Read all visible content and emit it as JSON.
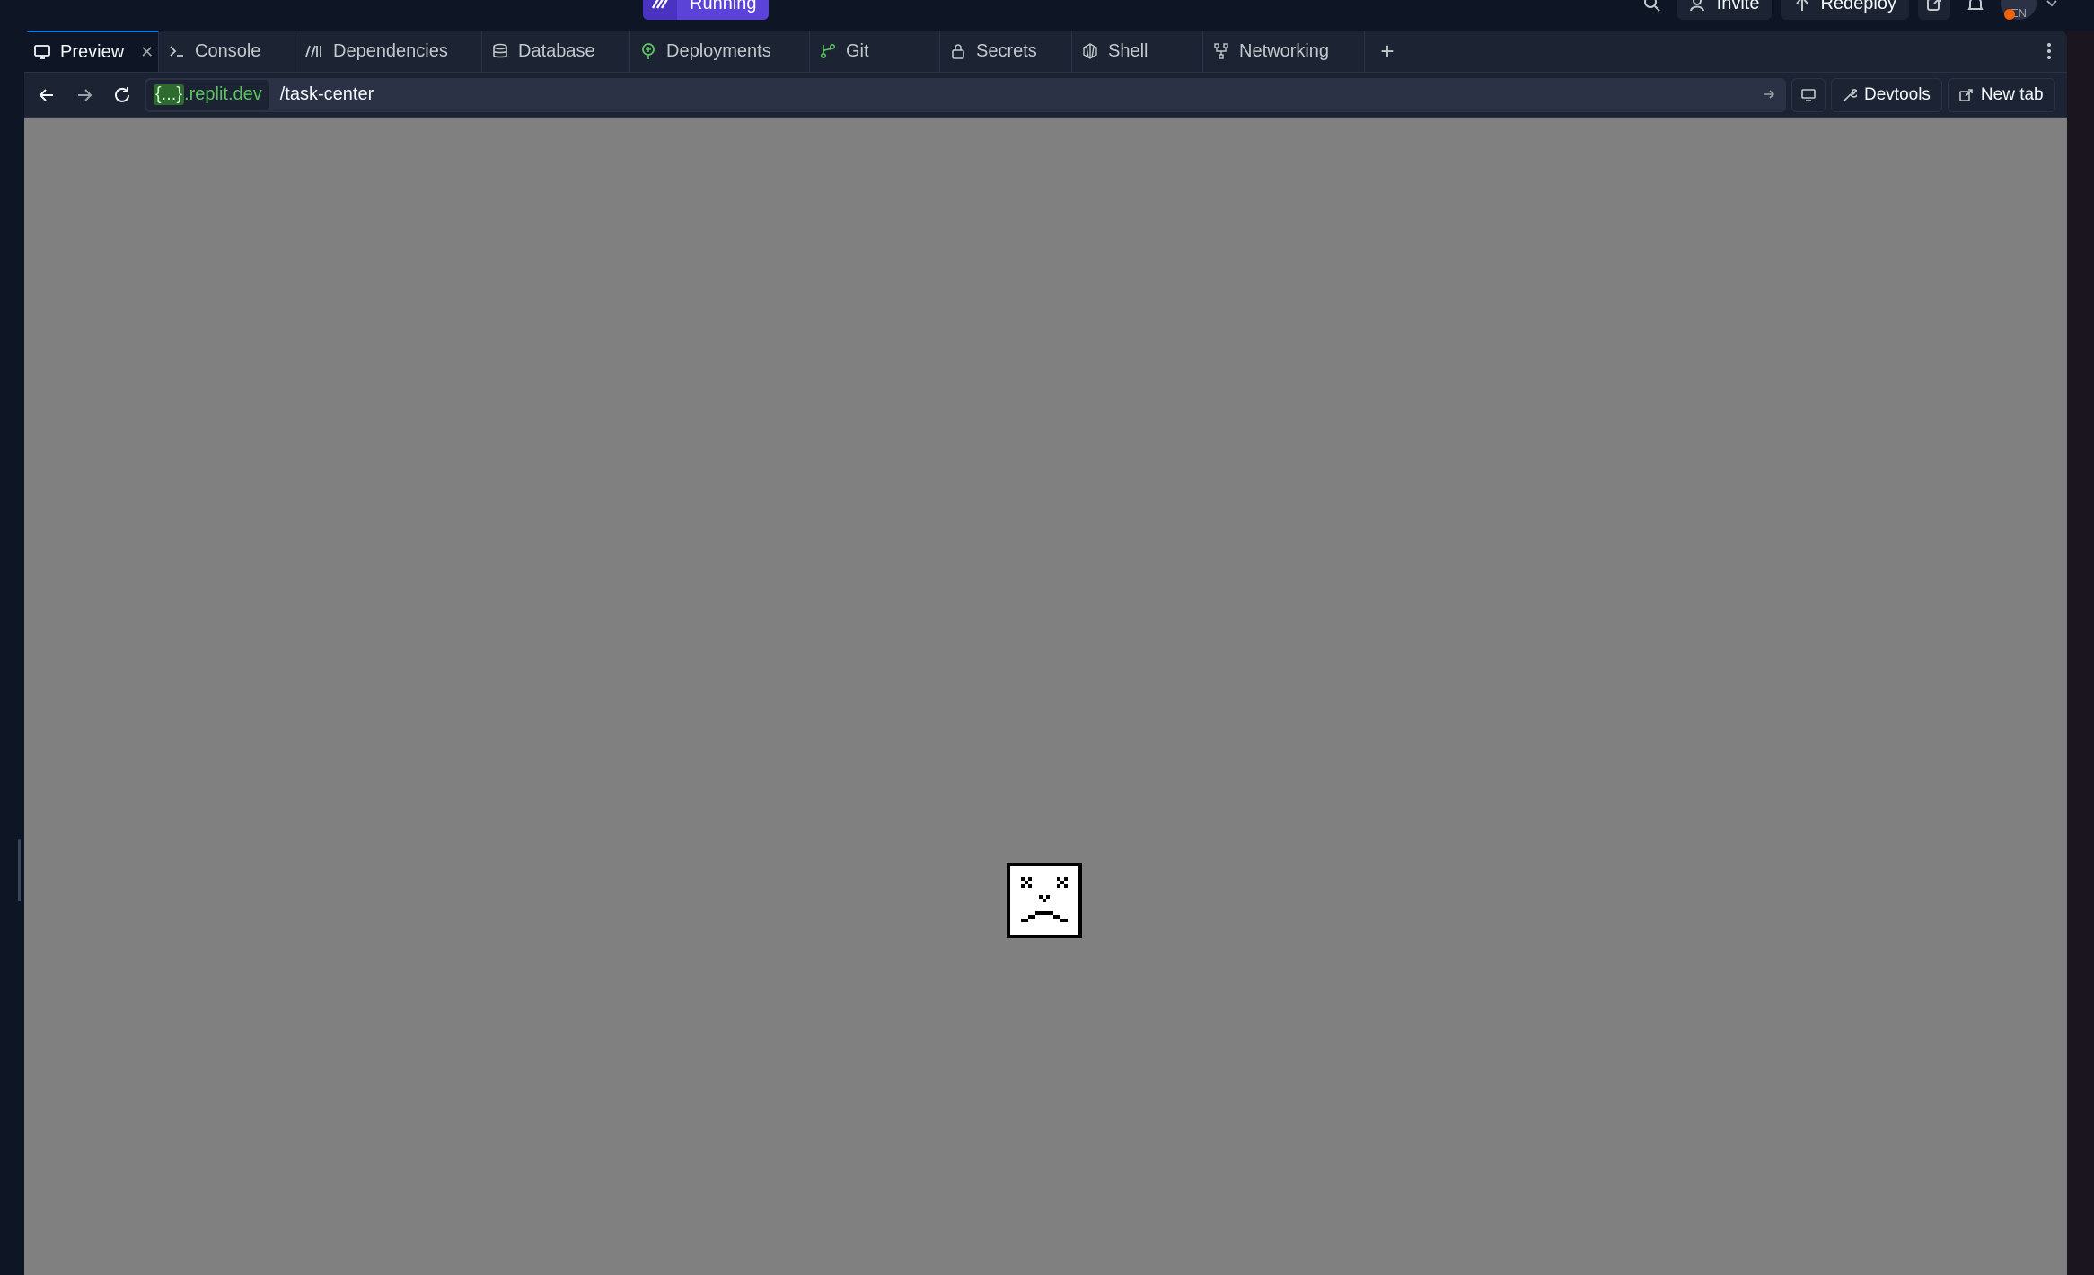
{
  "topbar": {
    "run_label": "Running",
    "invite_label": "Invite",
    "redeploy_label": "Redeploy",
    "avatar_initials": "EN"
  },
  "tabs": [
    {
      "label": "Preview",
      "icon": "monitor-icon",
      "active": true
    },
    {
      "label": "Console",
      "icon": "terminal-icon"
    },
    {
      "label": "Dependencies",
      "icon": "dependencies-icon"
    },
    {
      "label": "Database",
      "icon": "database-icon"
    },
    {
      "label": "Deployments",
      "icon": "deployments-icon"
    },
    {
      "label": "Git",
      "icon": "git-icon"
    },
    {
      "label": "Secrets",
      "icon": "lock-icon"
    },
    {
      "label": "Shell",
      "icon": "shell-icon"
    },
    {
      "label": "Networking",
      "icon": "networking-icon"
    }
  ],
  "urlbar": {
    "domain_brace": "{...}",
    "domain_rest": ".replit.dev",
    "path": "/task-center",
    "devtools_label": "Devtools",
    "newtab_label": "New tab"
  },
  "colors": {
    "bg": "#0e1525",
    "panel": "#1c2333",
    "accent": "#5a43d6",
    "domain_green": "#5cc35f",
    "viewport_gray": "#808080"
  }
}
